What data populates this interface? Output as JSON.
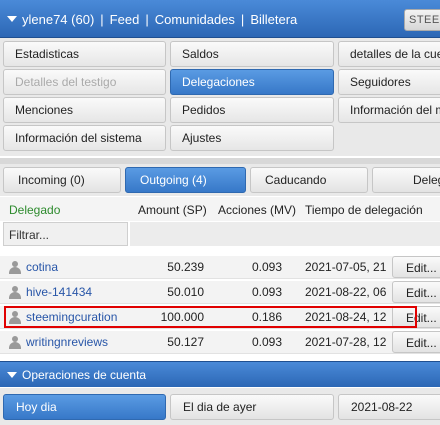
{
  "topbar": {
    "user": "ylene74 (60)",
    "links": [
      "Feed",
      "Comunidades",
      "Billetera"
    ],
    "steem_button": "STEEM"
  },
  "menu": {
    "items": [
      "Estadisticas",
      "Saldos",
      "detalles de la cuenta",
      "Detalles del testigo",
      "Delegaciones",
      "Seguidores",
      "Menciones",
      "Pedidos",
      "Información del mercado",
      "Información del sistema",
      "Ajustes"
    ],
    "active": "Delegaciones",
    "disabled": "Detalles del testigo"
  },
  "tabs": {
    "items": [
      "Incoming (0)",
      "Outgoing (4)",
      "Caducando",
      "Delegar"
    ],
    "active": "Outgoing (4)"
  },
  "table": {
    "headers": [
      "Delegado",
      "Amount (SP)",
      "Acciones (MV)",
      "Tiempo de delegación"
    ],
    "filter_placeholder": "Filtrar...",
    "edit_label": "Edit...",
    "rows": [
      {
        "user": "cotina",
        "amount": "50.239",
        "mv": "0.093",
        "date": "2021-07-05, 21:"
      },
      {
        "user": "hive-141434",
        "amount": "50.010",
        "mv": "0.093",
        "date": "2021-08-22, 06:"
      },
      {
        "user": "steemingcuration",
        "amount": "100.000",
        "mv": "0.186",
        "date": "2021-08-24, 12:"
      },
      {
        "user": "writingnreviews",
        "amount": "50.127",
        "mv": "0.093",
        "date": "2021-07-28, 12:"
      }
    ],
    "highlighted_row": "steemingcuration"
  },
  "operations": {
    "title": "Operaciones de cuenta",
    "buttons": [
      "Hoy dia",
      "El dia de ayer",
      "2021-08-22"
    ],
    "active": "Hoy dia"
  },
  "colors": {
    "accent": "#3778c8",
    "link": "#2856a8",
    "header_green": "#2e8b2e",
    "highlight_red": "#e00000"
  }
}
